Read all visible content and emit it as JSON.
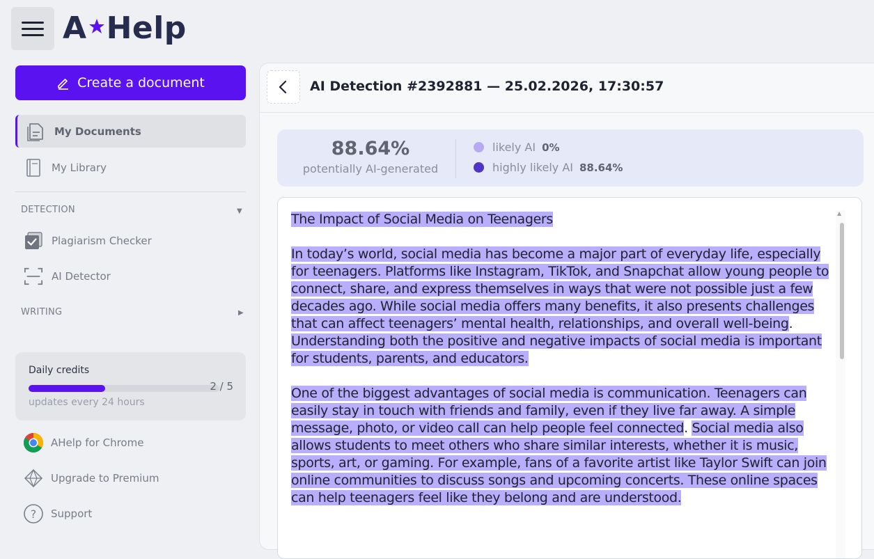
{
  "header": {
    "logo_text_left": "A",
    "logo_text_right": "Help"
  },
  "sidebar": {
    "create_label": "Create a document",
    "items": [
      {
        "label": "My Documents",
        "icon": "documents-icon",
        "active": true
      },
      {
        "label": "My Library",
        "icon": "book-icon",
        "active": false
      }
    ],
    "detection_label": "DETECTION",
    "detection_items": [
      {
        "label": "Plagiarism Checker",
        "icon": "checkbox-icon"
      },
      {
        "label": "AI Detector",
        "icon": "scan-icon"
      }
    ],
    "writing_label": "WRITING",
    "credits": {
      "title": "Daily credits",
      "used": 2,
      "total": 5,
      "count_text": "2 / 5",
      "fill_fraction": 0.4,
      "subtitle": "updates every 24 hours"
    },
    "bottom_items": [
      {
        "label": "AHelp for Chrome",
        "icon": "chrome-icon"
      },
      {
        "label": "Upgrade to Premium",
        "icon": "diamond-icon"
      },
      {
        "label": "Support",
        "icon": "help-icon"
      }
    ]
  },
  "main": {
    "title": "AI Detection #2392881 — 25.02.2026, 17:30:57",
    "score": {
      "value": "88.64%",
      "label": "potentially AI-generated"
    },
    "legend": [
      {
        "label": "likely AI",
        "value": "0%",
        "color": "#b8aaf0"
      },
      {
        "label": "highly likely AI",
        "value": "88.64%",
        "color": "#5133c8"
      }
    ],
    "highlight_color": "#b9aefc",
    "accent_color": "#5a12f0",
    "document": {
      "title": "The Impact of Social Media on Teenagers",
      "p1_a": "In today’s world, social media has become a major part of everyday life, especially for teenagers. Platforms like Instagram, TikTok, and Snapchat allow young people to connect, share, and express themselves in ways that were not possible just a few decades ago. While social media offers many benefits, it also presents challenges that can affect teenagers’ mental health, relationships, and overall well-being",
      "p1_sep": ". ",
      "p1_b": "Understanding both the positive and negative impacts of social media is important for students, parents, and educators.",
      "p2_a": "One of the biggest advantages of social media is communication. Teenagers can easily stay in touch with friends and family, even if they live far away. A simple message, photo, or video call can help people feel connected",
      "p2_sep": ". ",
      "p2_b": "Social media also allows students to meet others who share similar interests, whether it is music, sports, art, or gaming. For example, fans of a favorite artist like Taylor Swift can join online communities to discuss songs and upcoming concerts. These online spaces can help teenagers feel like they belong and are understood."
    }
  }
}
